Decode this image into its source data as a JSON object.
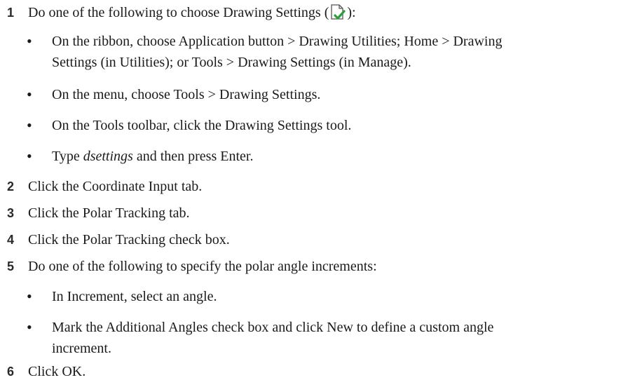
{
  "steps": [
    {
      "number": "1",
      "text_before_icon": "Do one of the following to choose Drawing Settings (",
      "icon": "drawing-settings-icon",
      "text_after_icon": "):",
      "bullets": [
        {
          "lines": [
            "On the ribbon, choose Application button > Drawing Utilities; Home > Drawing",
            "Settings (in Utilities); or Tools > Drawing Settings (in Manage)."
          ]
        },
        {
          "lines": [
            "On the menu, choose Tools > Drawing Settings."
          ]
        },
        {
          "lines": [
            "On the Tools toolbar, click the Drawing Settings tool."
          ]
        },
        {
          "prefix": "Type ",
          "emphasis": "dsettings",
          "suffix": " and then press Enter."
        }
      ]
    },
    {
      "number": "2",
      "text": "Click the Coordinate Input tab."
    },
    {
      "number": "3",
      "text": "Click the Polar Tracking tab."
    },
    {
      "number": "4",
      "text": "Click the Polar Tracking check box."
    },
    {
      "number": "5",
      "text": "Do one of the following to specify the polar angle increments:",
      "bullets": [
        {
          "lines": [
            "In Increment, select an angle."
          ]
        },
        {
          "lines": [
            "Mark the Additional Angles check box and click New to define a custom angle",
            "increment."
          ]
        }
      ]
    },
    {
      "number": "6",
      "text": "Click OK."
    }
  ],
  "colors": {
    "icon_check": "#2e9e3a",
    "icon_page": "#555555"
  }
}
